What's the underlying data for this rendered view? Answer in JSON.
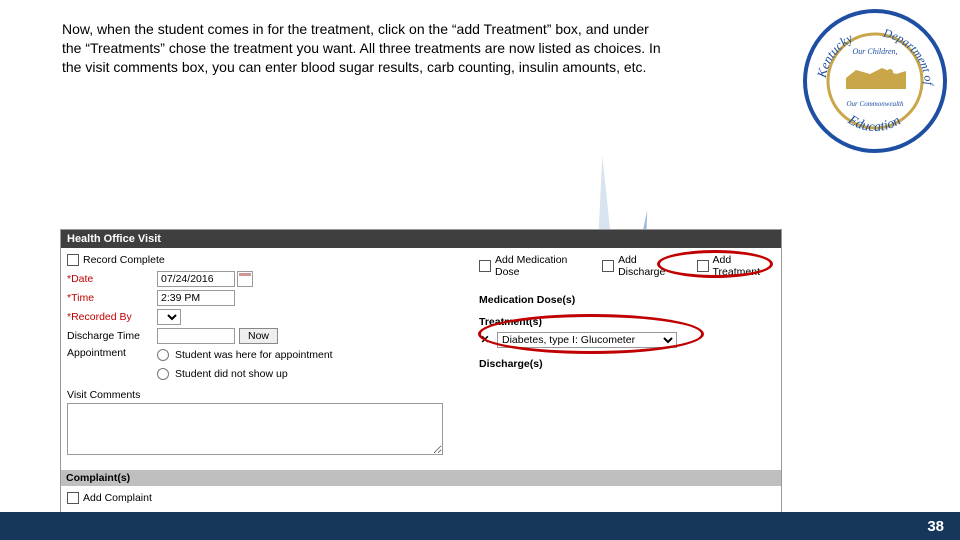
{
  "instructions": "Now, when the student comes in for the treatment, click on the “add Treatment” box, and under the “Treatments” chose the treatment you want. All three treatments are now listed as choices.  In the visit comments box, you can enter blood sugar results, carb counting, insulin amounts, etc.",
  "page_number": "38",
  "logo": {
    "org_top": "Department of",
    "org_left": "Kentucky",
    "org_bottom": "Education",
    "center_top": "Our Children,",
    "center_bottom": "Our Commonwealth"
  },
  "panel": {
    "title": "Health Office Visit",
    "left": {
      "record_complete": "Record Complete",
      "date_label": "*Date",
      "date_value": "07/24/2016",
      "time_label": "*Time",
      "time_value": "2:39 PM",
      "recorded_by_label": "*Recorded By",
      "discharge_time_label": "Discharge Time",
      "now_btn": "Now",
      "appointment_label": "Appointment",
      "appt_here": "Student was here for appointment",
      "appt_noshow": "Student did not show up",
      "visit_comments_label": "Visit Comments",
      "complaints_hdr": "Complaint(s)",
      "add_complaint": "Add Complaint"
    },
    "right": {
      "add_medication_dose": "Add Medication Dose",
      "add_discharge": "Add Discharge",
      "add_treatment": "Add Treatment",
      "med_dose_hdr": "Medication Dose(s)",
      "treatments_hdr": "Treatment(s)",
      "treatment_selected": "Diabetes, type I: Glucometer",
      "discharges_hdr": "Discharge(s)"
    }
  }
}
